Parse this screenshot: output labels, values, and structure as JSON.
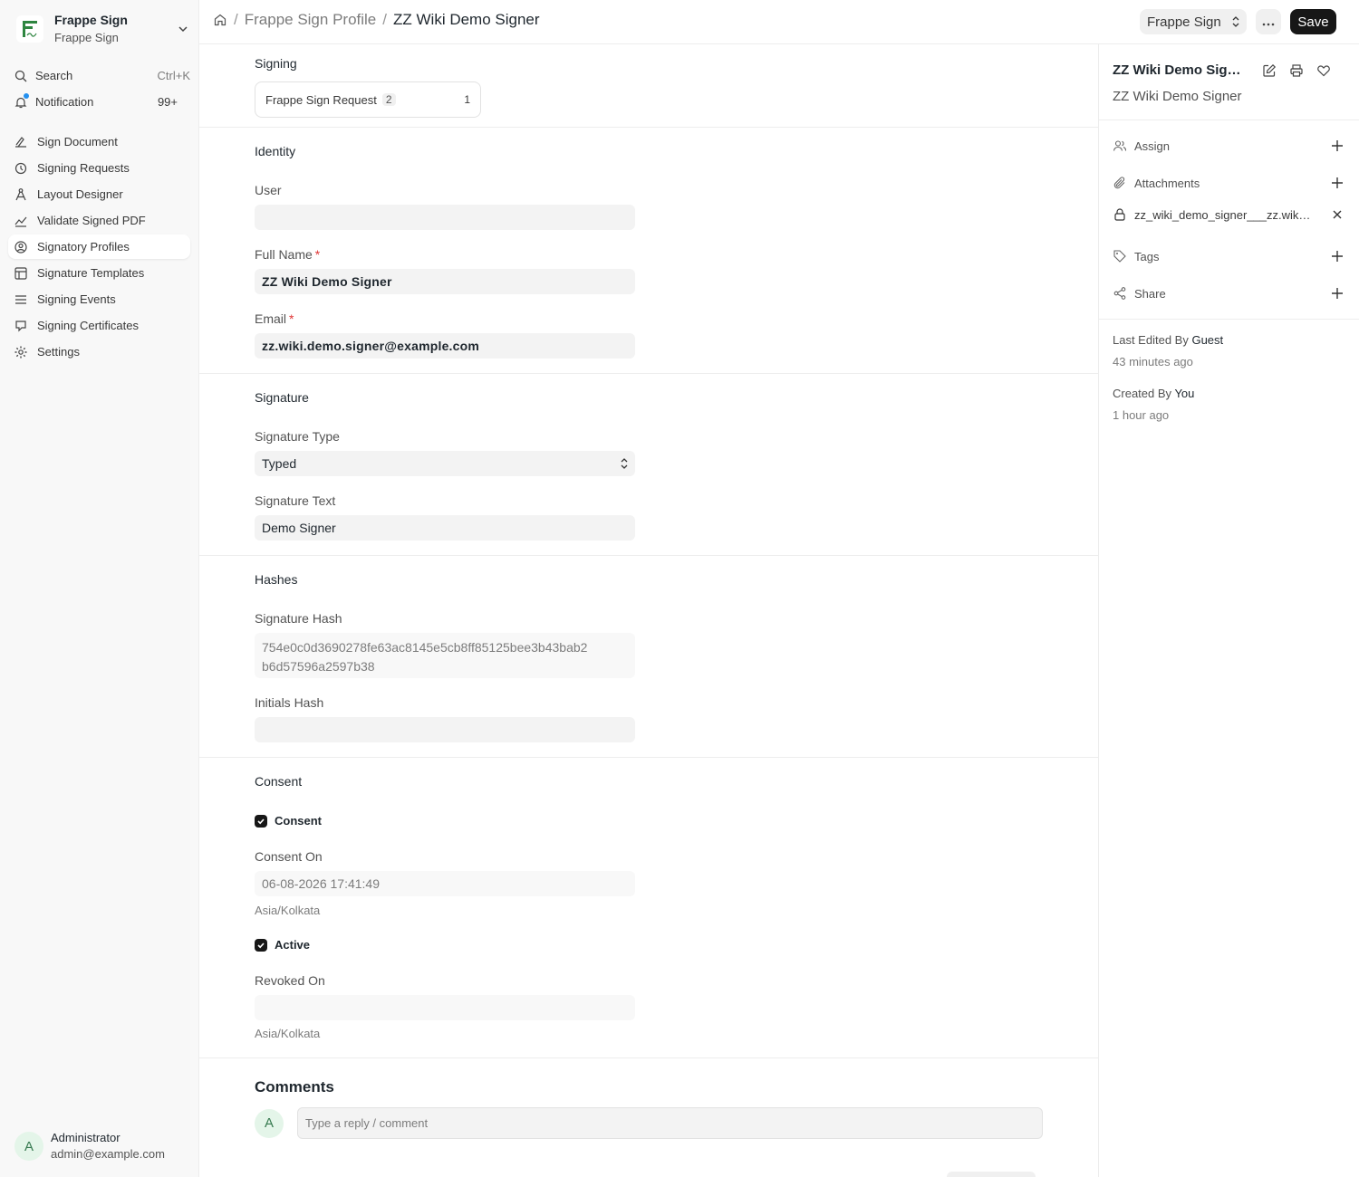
{
  "app": {
    "name": "Frappe Sign",
    "sub": "Frappe Sign"
  },
  "sidebar": {
    "search_label": "Search",
    "search_shortcut": "Ctrl+K",
    "notification_label": "Notification",
    "notification_count": "99+",
    "items": [
      {
        "label": "Sign Document",
        "icon": "sign-document-icon"
      },
      {
        "label": "Signing Requests",
        "icon": "signing-requests-icon"
      },
      {
        "label": "Layout Designer",
        "icon": "layout-designer-icon"
      },
      {
        "label": "Validate Signed PDF",
        "icon": "validate-icon"
      },
      {
        "label": "Signatory Profiles",
        "icon": "signatory-profiles-icon",
        "active": true
      },
      {
        "label": "Signature Templates",
        "icon": "templates-icon"
      },
      {
        "label": "Signing Events",
        "icon": "events-icon"
      },
      {
        "label": "Signing Certificates",
        "icon": "certificates-icon"
      },
      {
        "label": "Settings",
        "icon": "settings-icon"
      }
    ],
    "user": {
      "initial": "A",
      "name": "Administrator",
      "email": "admin@example.com"
    }
  },
  "header": {
    "breadcrumb_sep": "/",
    "breadcrumb_parent": "Frappe Sign Profile",
    "breadcrumb_current": "ZZ Wiki Demo Signer",
    "app_select": "Frappe Sign",
    "save_label": "Save"
  },
  "form": {
    "signing": {
      "title": "Signing",
      "link_label": "Frappe Sign Request",
      "link_badge": "2",
      "link_count": "1"
    },
    "identity": {
      "title": "Identity",
      "user_label": "User",
      "user_value": "",
      "full_name_label": "Full Name",
      "full_name_value": "ZZ Wiki Demo Signer",
      "email_label": "Email",
      "email_value": "zz.wiki.demo.signer@example.com",
      "required_mark": "*"
    },
    "signature": {
      "title": "Signature",
      "type_label": "Signature Type",
      "type_value": "Typed",
      "text_label": "Signature Text",
      "text_value": "Demo Signer"
    },
    "hashes": {
      "title": "Hashes",
      "sig_hash_label": "Signature Hash",
      "sig_hash_line1": "754e0c0d3690278fe63ac8145e5cb8ff85125bee3b43bab2",
      "sig_hash_line2": "b6d57596a2597b38",
      "initials_hash_label": "Initials Hash",
      "initials_hash_value": ""
    },
    "consent": {
      "title": "Consent",
      "consent_checkbox": "Consent",
      "consent_on_label": "Consent On",
      "consent_on_value": "06-08-2026 17:41:49",
      "timezone": "Asia/Kolkata",
      "active_checkbox": "Active",
      "revoked_on_label": "Revoked On",
      "revoked_on_value": "",
      "timezone2": "Asia/Kolkata"
    },
    "comments": {
      "title": "Comments",
      "avatar": "A",
      "placeholder": "Type a reply / comment"
    }
  },
  "right_panel": {
    "title": "ZZ Wiki Demo Signer",
    "subtitle": "ZZ Wiki Demo Signer",
    "assign_label": "Assign",
    "attachments_label": "Attachments",
    "attachment_file": "zz_wiki_demo_signer___zz.wiki.demo.signer_example.com.png",
    "tags_label": "Tags",
    "share_label": "Share",
    "last_edited_prefix": "Last Edited By",
    "last_edited_by": "Guest",
    "last_edited_when": "43 minutes ago",
    "created_prefix": "Created By",
    "created_by": "You",
    "created_when": "1 hour ago"
  },
  "colors": {
    "accent": "#171717",
    "brand_green": "#2e8540",
    "notification_dot": "#2490ef",
    "required": "#e03636"
  }
}
